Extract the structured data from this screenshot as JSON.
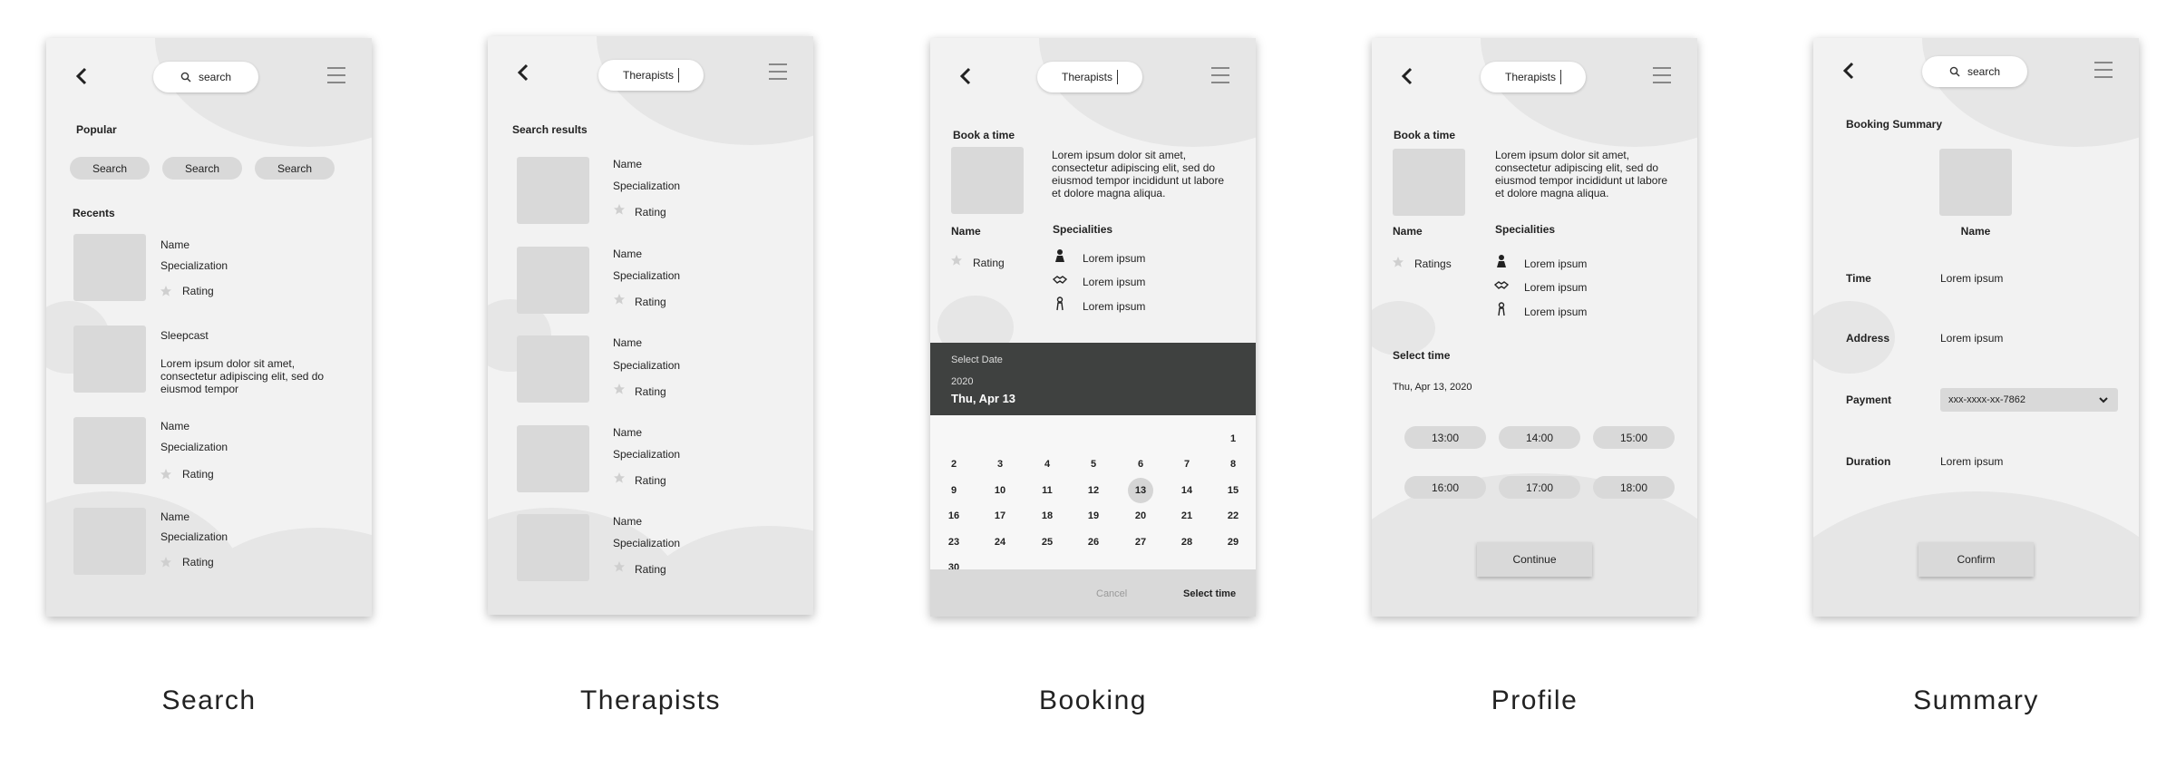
{
  "screens": {
    "search": {
      "caption": "Search",
      "search_placeholder": "search",
      "popular_title": "Popular",
      "popular_pills": [
        "Search",
        "Search",
        "Search"
      ],
      "recents_title": "Recents",
      "items": [
        {
          "line1": "Name",
          "line2": "Specialization",
          "rating": "Rating"
        },
        {
          "line1": "Sleepcast",
          "line2": "Lorem ipsum dolor sit amet, consectetur adipiscing elit, sed do eiusmod tempor"
        },
        {
          "line1": "Name",
          "line2": "Specialization",
          "rating": "Rating"
        },
        {
          "line1": "Name",
          "line2": "Specialization",
          "rating": "Rating"
        }
      ]
    },
    "therapists": {
      "caption": "Therapists",
      "search_value": "Therapists",
      "results_title": "Search results",
      "items": [
        {
          "name": "Name",
          "spec": "Specialization",
          "rating": "Rating"
        },
        {
          "name": "Name",
          "spec": "Specialization",
          "rating": "Rating"
        },
        {
          "name": "Name",
          "spec": "Specialization",
          "rating": "Rating"
        },
        {
          "name": "Name",
          "spec": "Specialization",
          "rating": "Rating"
        },
        {
          "name": "Name",
          "spec": "Specialization",
          "rating": "Rating"
        }
      ]
    },
    "booking": {
      "caption": "Booking",
      "search_value": "Therapists",
      "book_title": "Book a time",
      "description": "Lorem ipsum dolor sit amet, consectetur adipiscing elit, sed do eiusmod tempor incididunt ut labore et dolore magna aliqua.",
      "name": "Name",
      "rating": "Rating",
      "specialities_title": "Specialities",
      "specialities": [
        "Lorem ipsum",
        "Lorem ipsum",
        "Lorem ipsum"
      ],
      "calendar": {
        "header_label": "Select Date",
        "year": "2020",
        "selected_date": "Thu, Apr 13",
        "days": [
          "1",
          "2",
          "3",
          "4",
          "5",
          "6",
          "7",
          "8",
          "9",
          "10",
          "11",
          "12",
          "13",
          "14",
          "15",
          "16",
          "17",
          "18",
          "19",
          "20",
          "21",
          "22",
          "23",
          "24",
          "25",
          "26",
          "27",
          "28",
          "29",
          "30"
        ],
        "selected_day": "13",
        "cancel": "Cancel",
        "confirm": "Select time"
      }
    },
    "profile": {
      "caption": "Profile",
      "search_value": "Therapists",
      "book_title": "Book a time",
      "description": "Lorem ipsum dolor sit amet, consectetur adipiscing elit, sed do eiusmod tempor incididunt ut labore et dolore magna aliqua.",
      "name": "Name",
      "rating": "Ratings",
      "specialities_title": "Specialities",
      "specialities": [
        "Lorem ipsum",
        "Lorem ipsum",
        "Lorem ipsum"
      ],
      "select_time_title": "Select time",
      "date": "Thu, Apr 13, 2020",
      "times": [
        "13:00",
        "14:00",
        "15:00",
        "16:00",
        "17:00",
        "18:00"
      ],
      "continue": "Continue"
    },
    "summary": {
      "caption": "Summary",
      "search_placeholder": "search",
      "title": "Booking Summary",
      "name": "Name",
      "rows": [
        {
          "label": "Time",
          "value": "Lorem ipsum"
        },
        {
          "label": "Address",
          "value": "Lorem ipsum"
        },
        {
          "label": "Payment",
          "value": "xxx-xxxx-xx-7862"
        },
        {
          "label": "Duration",
          "value": "Lorem ipsum"
        }
      ],
      "confirm": "Confirm"
    }
  },
  "colors": {
    "screen_bg": "#f2f2f2",
    "blob": "#e6e6e6",
    "thumb": "#d9d9d9",
    "calendar_header": "#3f4140"
  },
  "icons": [
    "back-arrow-icon",
    "hamburger-menu-icon",
    "search-icon",
    "star-icon",
    "chevron-down-icon"
  ]
}
